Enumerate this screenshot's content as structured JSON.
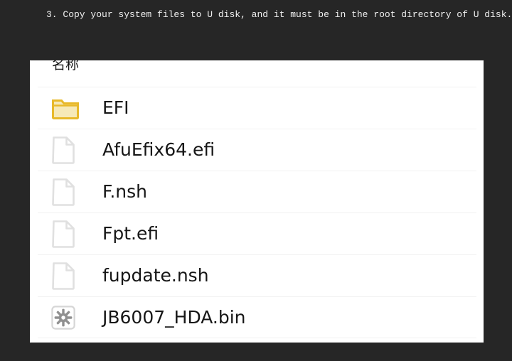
{
  "instruction": {
    "text": "3. Copy your system files to U disk, and it must be in the root directory of U disk."
  },
  "file_panel": {
    "column_header": "名称",
    "rows": [
      {
        "name": "EFI",
        "icon": "folder-icon"
      },
      {
        "name": "AfuEfix64.efi",
        "icon": "document-icon"
      },
      {
        "name": "F.nsh",
        "icon": "document-icon"
      },
      {
        "name": "Fpt.efi",
        "icon": "document-icon"
      },
      {
        "name": "fupdate.nsh",
        "icon": "document-icon"
      },
      {
        "name": "JB6007_HDA.bin",
        "icon": "system-file-icon"
      }
    ]
  },
  "colors": {
    "background": "#262626",
    "panel": "#ffffff",
    "text": "#161616",
    "instruction_text": "#f0f0f0",
    "folder_outline": "#e8b92a",
    "folder_fill": "#f6e9b8",
    "document_outline": "#e0e0e0",
    "separator": "#f2f2f2"
  }
}
